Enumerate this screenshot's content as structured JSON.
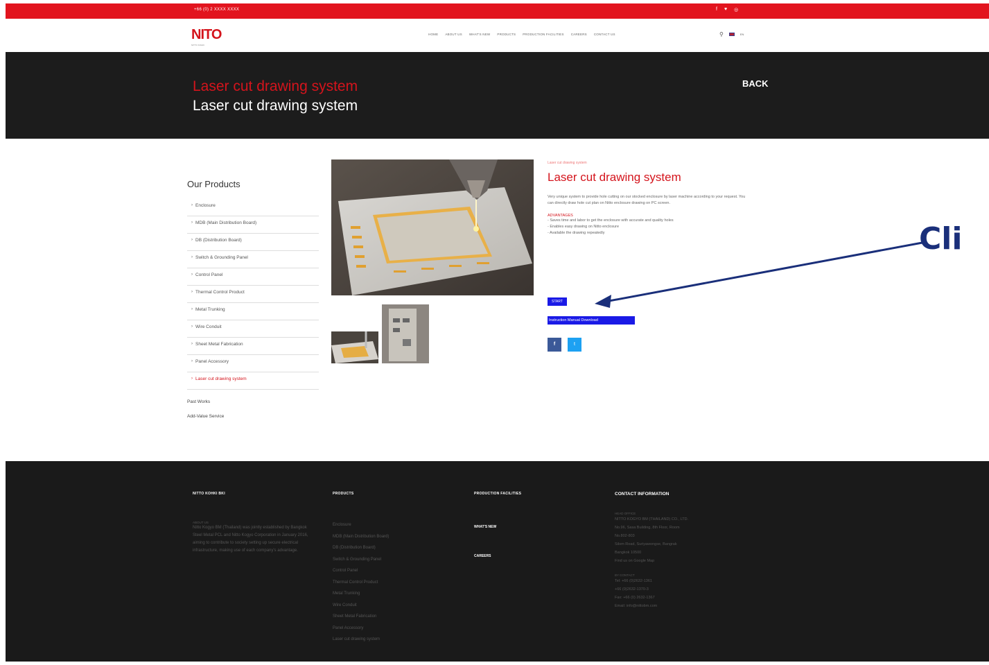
{
  "topbar": {
    "phone": "+66 (0) 2 XXXX XXXX",
    "social_icons": [
      "facebook-icon",
      "twitter-icon",
      "instagram-icon"
    ]
  },
  "header": {
    "logo": "NITO",
    "logo_sub": "NITTO KOHKI",
    "nav": [
      "HOME",
      "ABOUT US",
      "WHAT'S NEW",
      "PRODUCTS",
      "PRODUCTION FACILITIES",
      "CAREERS",
      "CONTACT US"
    ],
    "lang": "EN"
  },
  "hero": {
    "title_red": "Laser cut drawing system",
    "title_white": "Laser cut drawing system",
    "back": "BACK"
  },
  "sidebar": {
    "heading": "Our Products",
    "items": [
      "Enclosure",
      "MDB (Main Distribution Board)",
      "DB (Distribution Board)",
      "Switch & Grounding Panel",
      "Control Panel",
      "Thermal Control Product",
      "Metal Trunking",
      "Wire Conduit",
      "Sheet Metal Fabrication",
      "Panel Accessory",
      "Laser cut drawing system"
    ],
    "active_index": 10,
    "extra": [
      "Past Works",
      "Add-Value Service"
    ]
  },
  "product": {
    "breadcrumb": "Laser cut drawing system",
    "title": "Laser cut drawing system",
    "description": "Very unique system to provide hole cutting on our stocked enclosure by laser machine according to your request. You can directly draw hole cut plan on Nitto enclosure drawing on PC screen.",
    "advantages_title": "ADVANTAGES",
    "advantages": [
      "- Saves time and labor to get the enclosure with accurate and quality holes",
      "- Enables easy drawing on Nitto enclosure",
      "- Available the drawing repeatedly"
    ],
    "start_button": "START",
    "manual_button": "Instruction Manual Download",
    "share": [
      "f",
      "t"
    ]
  },
  "annotation": {
    "text": "Cli"
  },
  "footer": {
    "col1": {
      "heading": "NITTO KOHKI BKI",
      "label": "ABOUT US",
      "text": "Nitto Kogyo BM (Thailand) was jointly established by Bangkok Steel Metal PCL and Nitto Kogyo Corporation in January 2016, aiming to contribute to society setting up secure electrical infrastructure, making use of each company's advantage."
    },
    "col2": {
      "heading": "PRODUCTS",
      "items": [
        "Enclosure",
        "MDB (Main Distribution Board)",
        "DB (Distribution Board)",
        "Switch & Grounding Panel",
        "Control Panel",
        "Thermal Control Product",
        "Metal Trunking",
        "Wire Conduit",
        "Sheet Metal Fabrication",
        "Panel Accessory",
        "Laser cut drawing system"
      ]
    },
    "col3": {
      "heading": "PRODUCTION FACILITIES",
      "sub1": "WHAT'S NEW",
      "sub2": "CAREERS"
    },
    "col4": {
      "heading": "CONTACT INFORMATION",
      "label1": "HEAD OFFICE",
      "lines1": [
        "NITTO KOGYO BM (THAILAND) CO., LTD.",
        "No.96, Sasa Building, 8th Floor, Room",
        "No.802-803",
        "Silom Road, Suriyawongse, Bangrak",
        "Bangkok 10500",
        "Find us on Google Map"
      ],
      "label2": "BY CONTACT",
      "lines2": [
        "Tel: +66 (0)2632-1361",
        "+66 (0)2632-1370-3",
        "Fax: +66 (0) 2632-1367",
        "Email: info@nittobm.com"
      ]
    }
  }
}
